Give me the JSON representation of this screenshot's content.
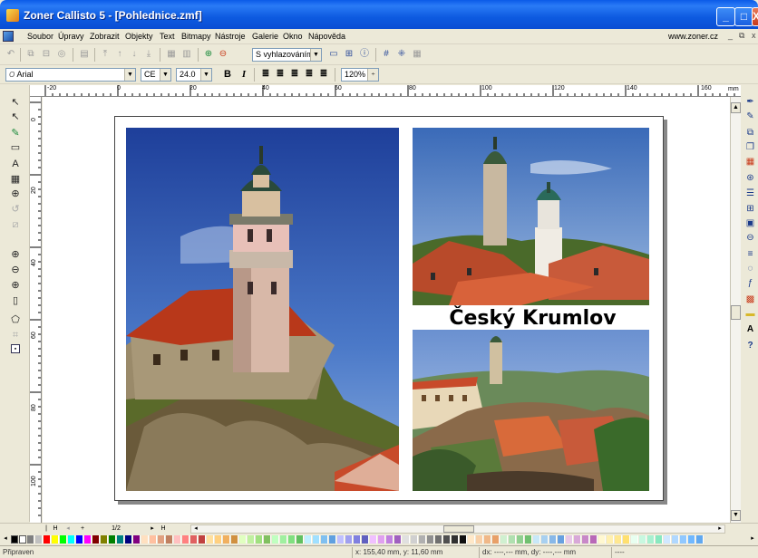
{
  "window": {
    "title": "Zoner Callisto 5 - [Pohlednice.zmf]",
    "min": "_",
    "max": "□",
    "close": "X"
  },
  "menu": {
    "items": [
      "Soubor",
      "Úpravy",
      "Zobrazit",
      "Objekty",
      "Text",
      "Bitmapy",
      "Nástroje",
      "Galerie",
      "Okno",
      "Nápověda"
    ],
    "site": "www.zoner.cz",
    "mdi": [
      "_",
      "⧉",
      "x"
    ]
  },
  "toolbar1": {
    "snap_mode": "S vyhlazováním"
  },
  "toolbar2": {
    "font": "Arial",
    "charset": "CE",
    "size": "24.0",
    "bold": "B",
    "italic": "I",
    "zoom": "120%"
  },
  "ruler": {
    "corner": "⊠",
    "h_labels": [
      "-20",
      "0",
      "20",
      "40",
      "60",
      "80",
      "100",
      "120",
      "140",
      "160"
    ],
    "unit": "mm",
    "v_labels": [
      "0",
      "20",
      "40",
      "60",
      "80",
      "100"
    ]
  },
  "postcard": {
    "caption": "Český Krumlov"
  },
  "pagebar": {
    "page": "1/2",
    "first": "H",
    "add": "+",
    "next": "▸",
    "last": "H"
  },
  "status": {
    "state": "Připraven",
    "coords": "x: 155,40 mm, y: 11,60 mm",
    "delta": "dx: ----,--- mm, dy: ----,--- mm",
    "extra": "----"
  },
  "colors": {
    "accent": "#0a5ae8"
  }
}
